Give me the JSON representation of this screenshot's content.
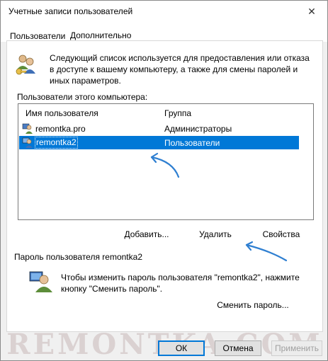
{
  "window": {
    "title": "Учетные записи пользователей",
    "close_glyph": "✕"
  },
  "tabs": [
    {
      "label": "Пользователи"
    },
    {
      "label": "Дополнительно"
    }
  ],
  "description": "Следующий список используется для предоставления или отказа в доступе к вашему компьютеру, а также для смены паролей и иных параметров.",
  "users_list": {
    "label": "Пользователи этого компьютера:",
    "columns": {
      "name": "Имя пользователя",
      "group": "Группа"
    },
    "rows": [
      {
        "name": "remontka.pro",
        "group": "Администраторы",
        "selected": false
      },
      {
        "name": "remontka2",
        "group": "Пользователи",
        "selected": true
      }
    ]
  },
  "list_buttons": {
    "add": "Добавить...",
    "remove": "Удалить",
    "properties": "Свойства"
  },
  "password": {
    "label": "Пароль пользователя remontka2",
    "text": "Чтобы изменить пароль пользователя \"remontka2\", нажмите кнопку \"Сменить пароль\".",
    "change_button": "Сменить пароль..."
  },
  "watermark": "REMONTKA.COM",
  "dialog_buttons": {
    "ok": "ОК",
    "cancel": "Отмена",
    "apply": "Применить"
  },
  "colors": {
    "selection": "#0078d7",
    "arrow": "#2f7fd1"
  },
  "icons": {
    "users": "users-icon",
    "user_admin": "user-admin-icon",
    "user": "user-icon",
    "password": "user-password-icon"
  }
}
